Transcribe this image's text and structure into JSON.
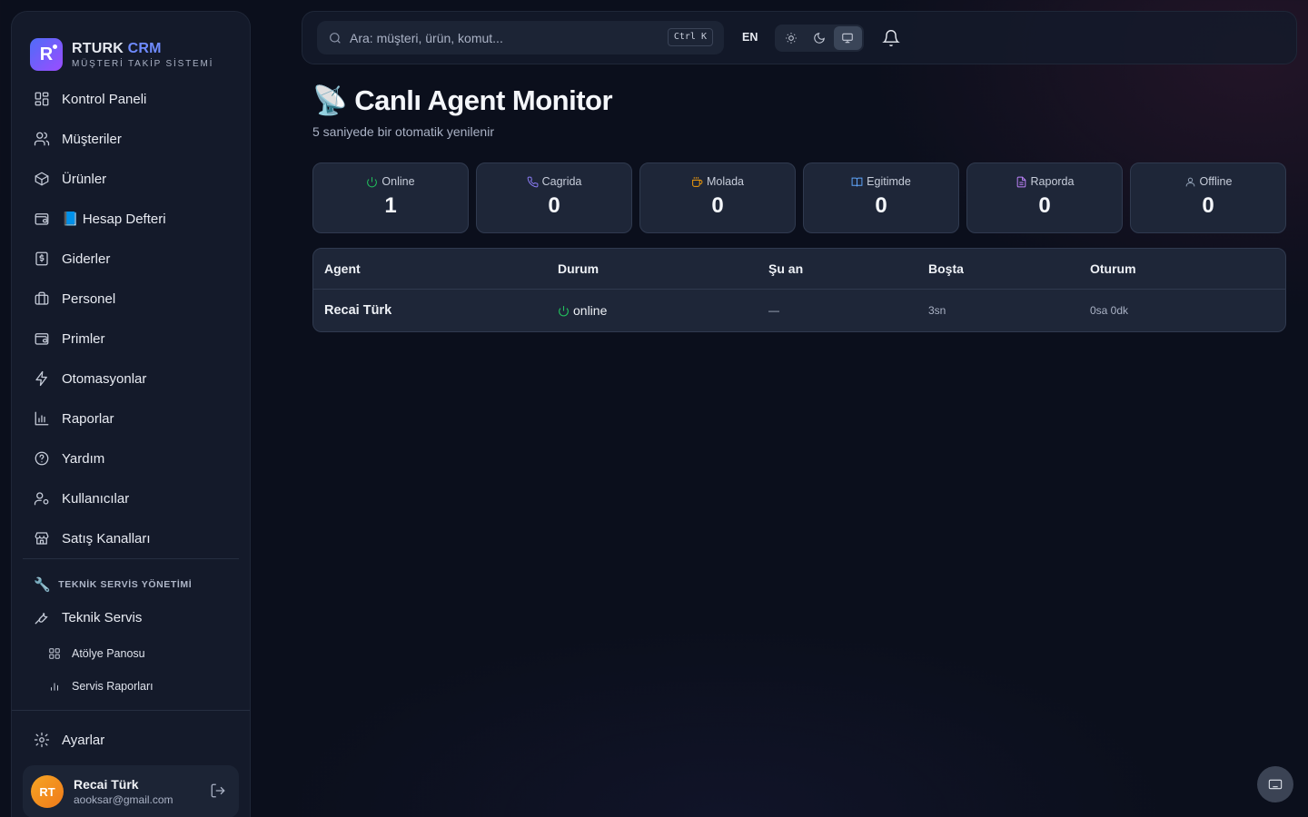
{
  "brand": {
    "name_a": "RTURK",
    "name_b": "CRM",
    "logo_letter": "R",
    "subtitle": "MÜŞTERİ TAKİP SİSTEMİ"
  },
  "sidebar": {
    "items": [
      {
        "label": "Kontrol Paneli",
        "icon": "dashboard-icon"
      },
      {
        "label": "Müşteriler",
        "icon": "users-icon"
      },
      {
        "label": "Ürünler",
        "icon": "package-icon"
      },
      {
        "label": "📘 Hesap Defteri",
        "icon": "wallet-icon"
      },
      {
        "label": "Giderler",
        "icon": "receipt-icon"
      },
      {
        "label": "Personel",
        "icon": "briefcase-icon"
      },
      {
        "label": "Primler",
        "icon": "wallet-icon"
      },
      {
        "label": "Otomasyonlar",
        "icon": "zap-icon"
      },
      {
        "label": "Raporlar",
        "icon": "bar-chart-icon"
      },
      {
        "label": "Yardım",
        "icon": "help-circle-icon"
      },
      {
        "label": "Kullanıcılar",
        "icon": "user-cog-icon"
      },
      {
        "label": "Satış Kanalları",
        "icon": "store-icon"
      }
    ],
    "section_title": "TEKNİK SERVİS YÖNETİMİ",
    "section_icon": "🔧",
    "service_item": "Teknik Servis",
    "sub_items": [
      {
        "label": "Atölye Panosu",
        "icon": "grid-icon"
      },
      {
        "label": "Servis Raporları",
        "icon": "bar-chart-icon"
      }
    ],
    "settings": "Ayarlar"
  },
  "user": {
    "initials": "RT",
    "name": "Recai Türk",
    "email": "aooksar@gmail.com"
  },
  "topbar": {
    "search_placeholder": "Ara: müşteri, ürün, komut...",
    "shortcut": "Ctrl K",
    "lang": "EN",
    "theme_options": [
      "light",
      "dark",
      "system"
    ],
    "theme_active": "system"
  },
  "page": {
    "title": "📡 Canlı Agent Monitor",
    "subtitle": "5 saniyede bir otomatik yenilenir"
  },
  "stats": [
    {
      "label": "Online",
      "value": "1",
      "icon": "power-icon",
      "color": "#22c55e"
    },
    {
      "label": "Cagrida",
      "value": "0",
      "icon": "phone-icon",
      "color": "#8b7cf6"
    },
    {
      "label": "Molada",
      "value": "0",
      "icon": "coffee-icon",
      "color": "#f59e0b"
    },
    {
      "label": "Egitimde",
      "value": "0",
      "icon": "book-icon",
      "color": "#60a5fa"
    },
    {
      "label": "Raporda",
      "value": "0",
      "icon": "file-icon",
      "color": "#c084fc"
    },
    {
      "label": "Offline",
      "value": "0",
      "icon": "user-icon",
      "color": "#94a3b8"
    }
  ],
  "table": {
    "headers": [
      "Agent",
      "Durum",
      "Şu an",
      "Boşta",
      "Oturum"
    ],
    "rows": [
      {
        "agent": "Recai Türk",
        "status": "online",
        "current": "—",
        "idle": "3sn",
        "session": "0sa 0dk"
      }
    ]
  }
}
